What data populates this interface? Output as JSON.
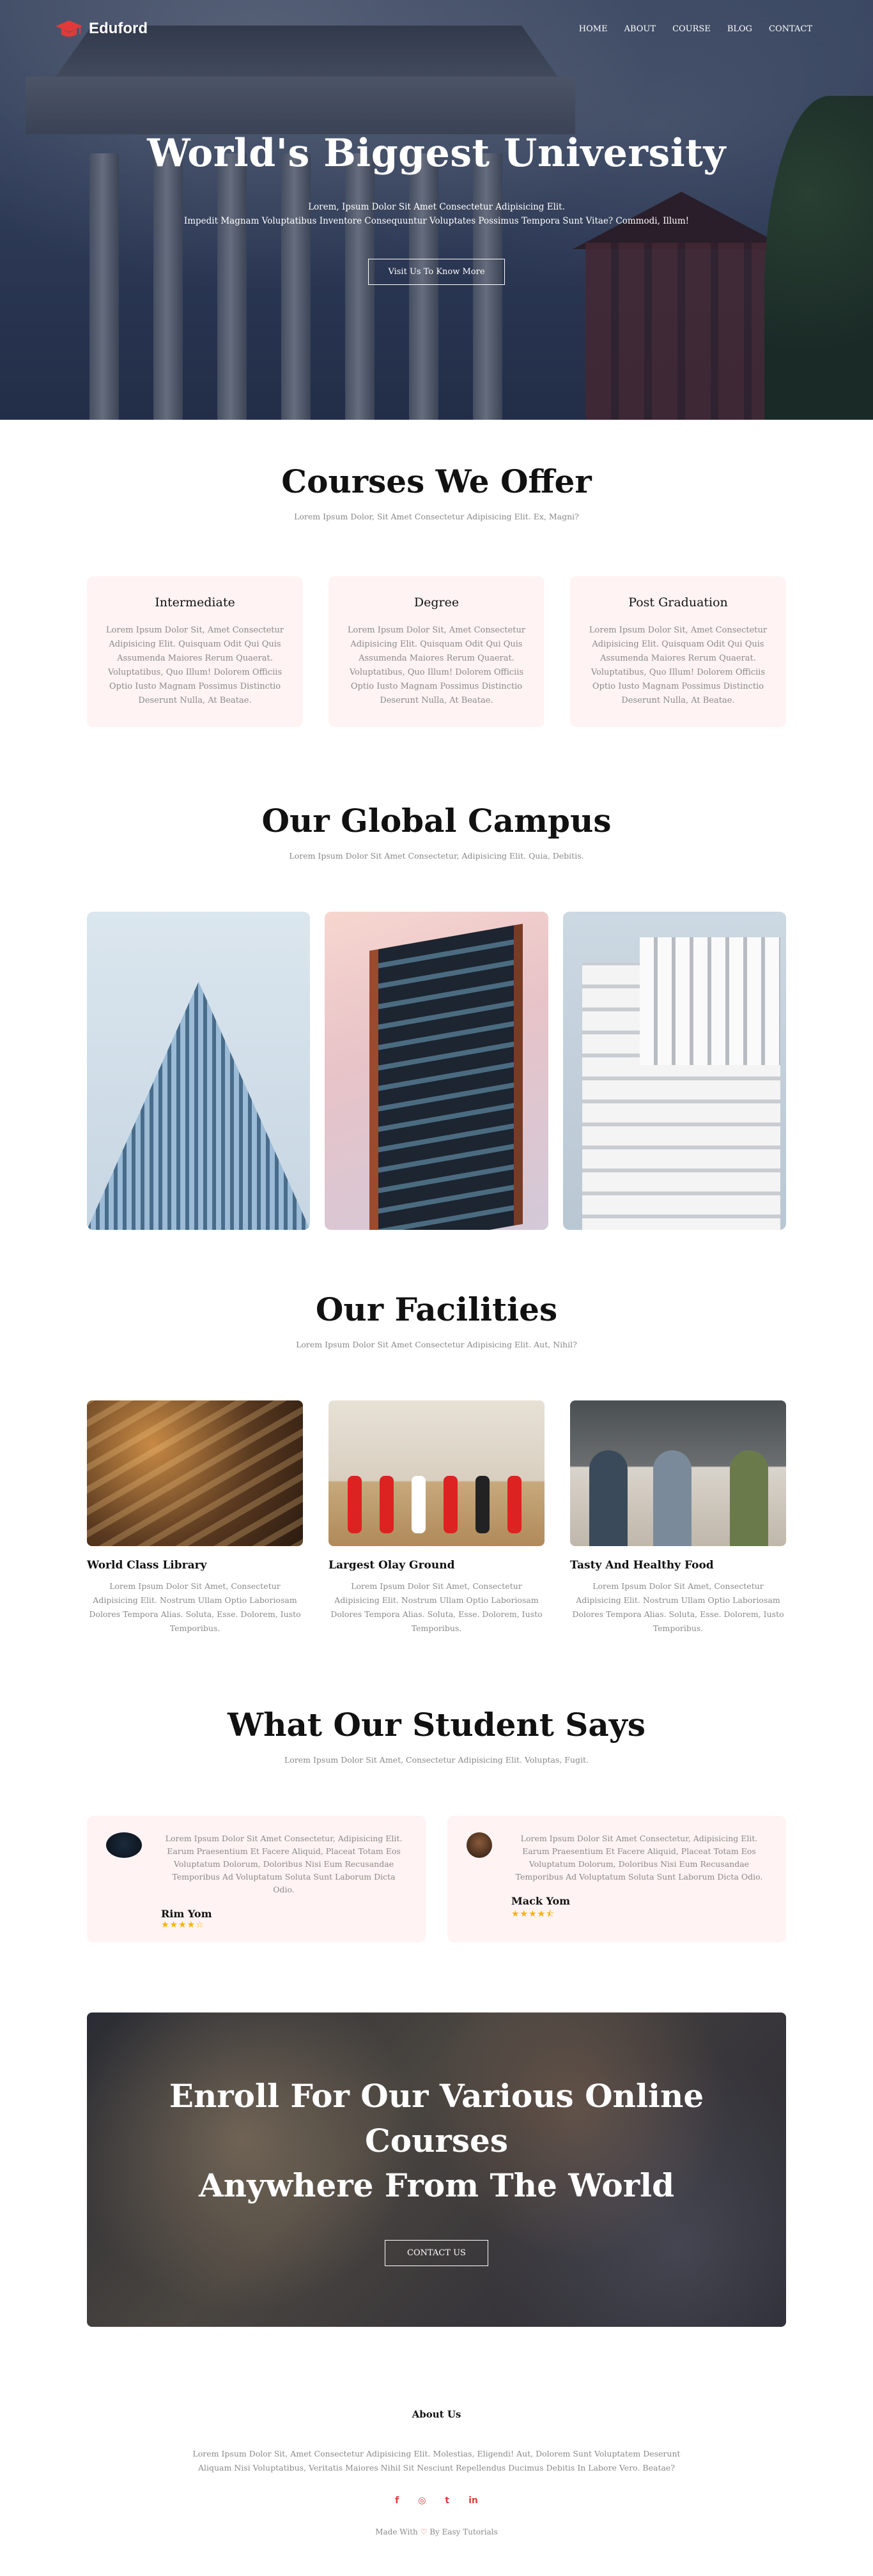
{
  "nav": {
    "logo": "Eduford",
    "items": [
      "HOME",
      "ABOUT",
      "COURSE",
      "BLOG",
      "CONTACT"
    ]
  },
  "hero": {
    "title": "World's Biggest University",
    "line1": "Lorem, Ipsum Dolor Sit Amet Consectetur Adipisicing Elit.",
    "line2": "Impedit Magnam Voluptatibus Inventore Consequuntur Voluptates Possimus Tempora Sunt Vitae? Commodi, Illum!",
    "button": "Visit Us To Know More"
  },
  "courses": {
    "title": "Courses We Offer",
    "subtitle": "Lorem Ipsum Dolor, Sit Amet Consectetur Adipisicing Elit. Ex, Magni?",
    "cards": [
      {
        "title": "Intermediate",
        "text": "Lorem Ipsum Dolor Sit, Amet Consectetur Adipisicing Elit. Quisquam Odit Qui Quis Assumenda Maiores Rerum Quaerat. Voluptatibus, Quo Illum! Dolorem Officiis Optio Iusto Magnam Possimus Distinctio Deserunt Nulla, At Beatae."
      },
      {
        "title": "Degree",
        "text": "Lorem Ipsum Dolor Sit, Amet Consectetur Adipisicing Elit. Quisquam Odit Qui Quis Assumenda Maiores Rerum Quaerat. Voluptatibus, Quo Illum! Dolorem Officiis Optio Iusto Magnam Possimus Distinctio Deserunt Nulla, At Beatae."
      },
      {
        "title": "Post Graduation",
        "text": "Lorem Ipsum Dolor Sit, Amet Consectetur Adipisicing Elit. Quisquam Odit Qui Quis Assumenda Maiores Rerum Quaerat. Voluptatibus, Quo Illum! Dolorem Officiis Optio Iusto Magnam Possimus Distinctio Deserunt Nulla, At Beatae."
      }
    ]
  },
  "campus": {
    "title": "Our Global Campus",
    "subtitle": "Lorem Ipsum Dolor Sit Amet Consectetur, Adipisicing Elit. Quia, Debitis."
  },
  "facilities": {
    "title": "Our Facilities",
    "subtitle": "Lorem Ipsum Dolor Sit Amet Consectetur Adipisicing Elit. Aut, Nihil?",
    "items": [
      {
        "title": "World Class Library",
        "text": "Lorem Ipsum Dolor Sit Amet, Consectetur Adipisicing Elit. Nostrum Ullam Optio Laboriosam Dolores Tempora Alias. Soluta, Esse. Dolorem, Iusto Temporibus."
      },
      {
        "title": "Largest Olay Ground",
        "text": "Lorem Ipsum Dolor Sit Amet, Consectetur Adipisicing Elit. Nostrum Ullam Optio Laboriosam Dolores Tempora Alias. Soluta, Esse. Dolorem, Iusto Temporibus."
      },
      {
        "title": "Tasty And Healthy Food",
        "text": "Lorem Ipsum Dolor Sit Amet, Consectetur Adipisicing Elit. Nostrum Ullam Optio Laboriosam Dolores Tempora Alias. Soluta, Esse. Dolorem, Iusto Temporibus."
      }
    ]
  },
  "testimonials": {
    "title": "What Our Student Says",
    "subtitle": "Lorem Ipsum Dolor Sit Amet, Consectetur Adipisicing Elit. Voluptas, Fugit.",
    "items": [
      {
        "name": "Rim Yom",
        "text": "Lorem Ipsum Dolor Sit Amet Consectetur, Adipisicing Elit. Earum Praesentium Et Facere Aliquid, Placeat Totam Eos Voluptatum Dolorum, Doloribus Nisi Eum Recusandae Temporibus Ad Voluptatum Soluta Sunt Laborum Dicta Odio.",
        "stars": "★★★★☆",
        "rating": 4
      },
      {
        "name": "Mack Yom",
        "text": "Lorem Ipsum Dolor Sit Amet Consectetur, Adipisicing Elit. Earum Praesentium Et Facere Aliquid, Placeat Totam Eos Voluptatum Dolorum, Doloribus Nisi Eum Recusandae Temporibus Ad Voluptatum Soluta Sunt Laborum Dicta Odio.",
        "stars": "★★★★⯪",
        "rating": 4.5
      }
    ]
  },
  "enroll": {
    "line1": "Enroll For Our Various Online",
    "line2": "Courses",
    "line3": "Anywhere From The World",
    "button": "CONTACT US"
  },
  "footer": {
    "title": "About Us",
    "line1": "Lorem Ipsum Dolor Sit, Amet Consectetur Adipisicing Elit. Molestias, Eligendi! Aut, Dolorem Sunt Voluptatem Deserunt",
    "line2": "Aliquam Nisi Voluptatibus, Veritatis Maiores Nihil Sit Nesciunt Repellendus Ducimus Debitis In Labore Vero. Beatae?",
    "socials": [
      "f",
      "◎",
      "t",
      "in"
    ],
    "made_prefix": "Made With",
    "made_suffix": "By Easy Tutorials"
  },
  "colors": {
    "accent": "#e23a3a",
    "card_bg": "#fff3f3",
    "star": "#f5b400"
  }
}
